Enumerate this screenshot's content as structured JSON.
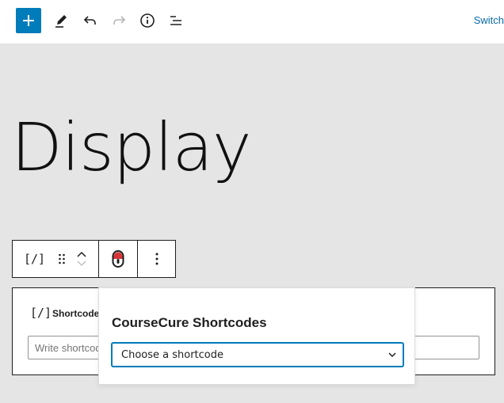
{
  "toolbar": {
    "add_icon": "plus-icon",
    "tools_icon": "pencil-icon",
    "undo_icon": "undo-icon",
    "redo_icon": "redo-icon",
    "info_icon": "info-icon",
    "outline_icon": "list-view-icon",
    "switch_label": "Switch"
  },
  "page": {
    "title": "Display"
  },
  "block_toolbar": {
    "block_type_glyph": "[/]",
    "drag_icon": "drag-handle-icon",
    "move_up_icon": "chevron-up-icon",
    "move_down_icon": "chevron-down-icon",
    "plugin_icon": "coursecure-icon",
    "more_icon": "more-vertical-icon"
  },
  "shortcode_block": {
    "glyph": "[/]",
    "label": "Shortcode",
    "input_placeholder": "Write shortcode here…"
  },
  "popover": {
    "title": "CourseCure Shortcodes",
    "select_value": "Choose a shortcode"
  },
  "colors": {
    "accent": "#007cba",
    "canvas": "#e5e5e5",
    "link": "#0a6ba8"
  }
}
